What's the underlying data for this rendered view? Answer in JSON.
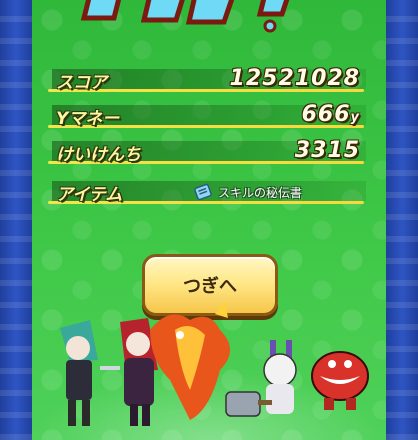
{
  "title": {
    "visible_fragment": "クリア!"
  },
  "results": [
    {
      "label": "スコア",
      "value": "12521028",
      "unit": ""
    },
    {
      "label": "Yマネー",
      "value": "666",
      "unit": "y"
    },
    {
      "label": "けいけんち",
      "value": "3315",
      "unit": ""
    }
  ],
  "item": {
    "label": "アイテム",
    "name": "スキルの秘伝書",
    "icon": "scroll-icon"
  },
  "next_button": {
    "label": "つぎへ"
  },
  "colors": {
    "field_green": "#3fc847",
    "border_blue": "#2746a8",
    "label_yellow": "#fff59a",
    "button_gold": "#ffe889"
  }
}
